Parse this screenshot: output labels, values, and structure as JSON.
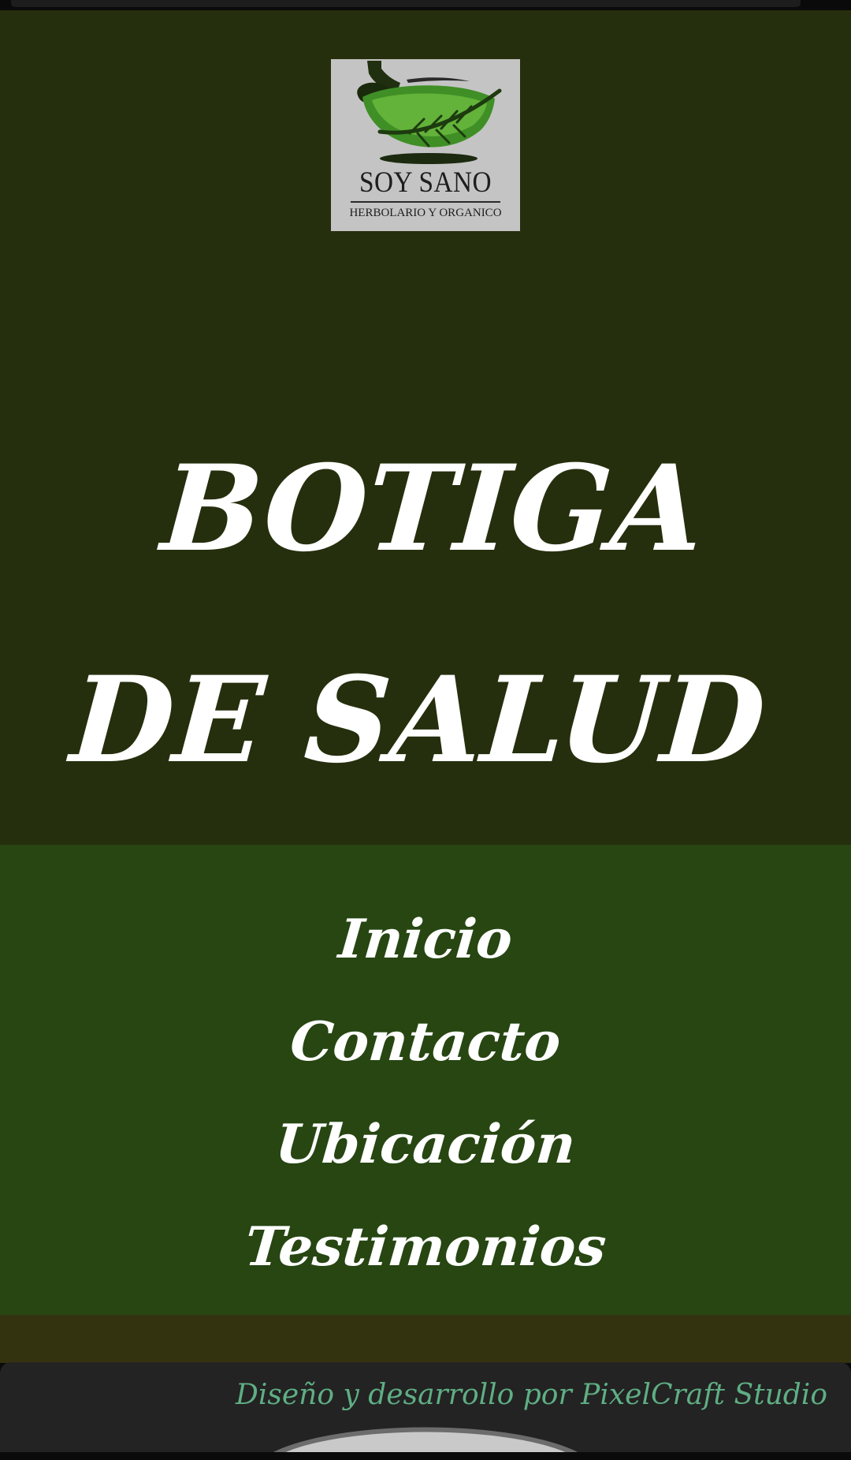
{
  "logo": {
    "name": "SOY SANO",
    "tagline": "HERBOLARIO Y ORGANICO",
    "icon": "mortar-leaf-icon"
  },
  "hero": {
    "title": "BOTIGA DE SALUD"
  },
  "nav": {
    "items": [
      {
        "label": "Inicio"
      },
      {
        "label": "Contacto"
      },
      {
        "label": "Ubicación"
      },
      {
        "label": "Testimonios"
      }
    ]
  },
  "footer": {
    "credit": "Diseño y desarrollo por PixelCraft Studio"
  },
  "colors": {
    "header_bg": "#252f0d",
    "nav_bg": "#274612",
    "band_bg": "#34330f",
    "footer_bg": "#232323",
    "credit_text": "#5fae84",
    "text": "#ffffff"
  }
}
